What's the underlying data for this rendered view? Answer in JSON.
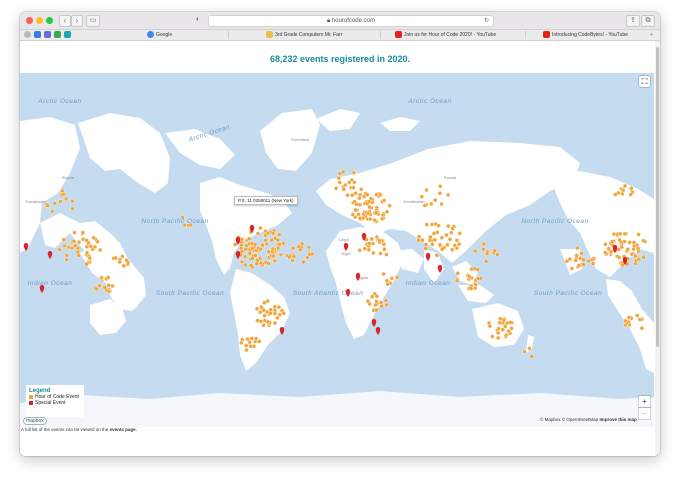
{
  "browser": {
    "url": "hourofcode.com",
    "traffic_lights": [
      "#fd5e57",
      "#febd2e",
      "#27c840"
    ],
    "bookmarks": [
      {
        "label": "Google",
        "icon": "google-icon",
        "color": "#4285f4"
      },
      {
        "label": "3rd Grade Computers Mr. Farr",
        "icon": "folder-icon",
        "color": "#e5c24a"
      },
      {
        "label": "Join us for Hour of Code 2020! - YouTube",
        "icon": "youtube-icon",
        "color": "#e62117"
      },
      {
        "label": "Introducing CodeBytes! - YouTube",
        "icon": "youtube-icon",
        "color": "#e62117"
      }
    ]
  },
  "page": {
    "heading": "68,232 events registered in 2020.",
    "footnote_prefix": "A full list of the events can be viewed on the",
    "footnote_link": "events page."
  },
  "map": {
    "tooltip": "P.S. 11 0258011 (New York)",
    "ocean_labels": [
      "Arctic Ocean",
      "Arctic Ocean",
      "Arctic Ocean",
      "North Pacific Ocean",
      "North Pacific Ocean",
      "Indian Ocean",
      "Indian Ocean",
      "South Pacific Ocean",
      "South Pacific Ocean",
      "South Atlantic Ocean"
    ],
    "place_labels": [
      "Russia",
      "Kazakhstan",
      "Greenland",
      "Russia",
      "Kazakhstan",
      "Libya",
      "Niger",
      "Angola"
    ],
    "legend": {
      "title": "Legend",
      "items": [
        {
          "label": "Hour of Code Event",
          "color": "#f0a43a"
        },
        {
          "label": "Special Event",
          "color": "#d9262a"
        }
      ]
    },
    "attribution": {
      "mapbox": "© Mapbox",
      "osm": "© OpenStreetMap",
      "improve": "Improve this map"
    },
    "logo": "mapbox",
    "controls": {
      "zoom_in": "+",
      "zoom_out": "−",
      "fullscreen": "⛶"
    },
    "colors": {
      "ocean": "#c5dbf0",
      "land": "#ffffff",
      "event": "#f0a43a",
      "special": "#d9262a"
    }
  }
}
